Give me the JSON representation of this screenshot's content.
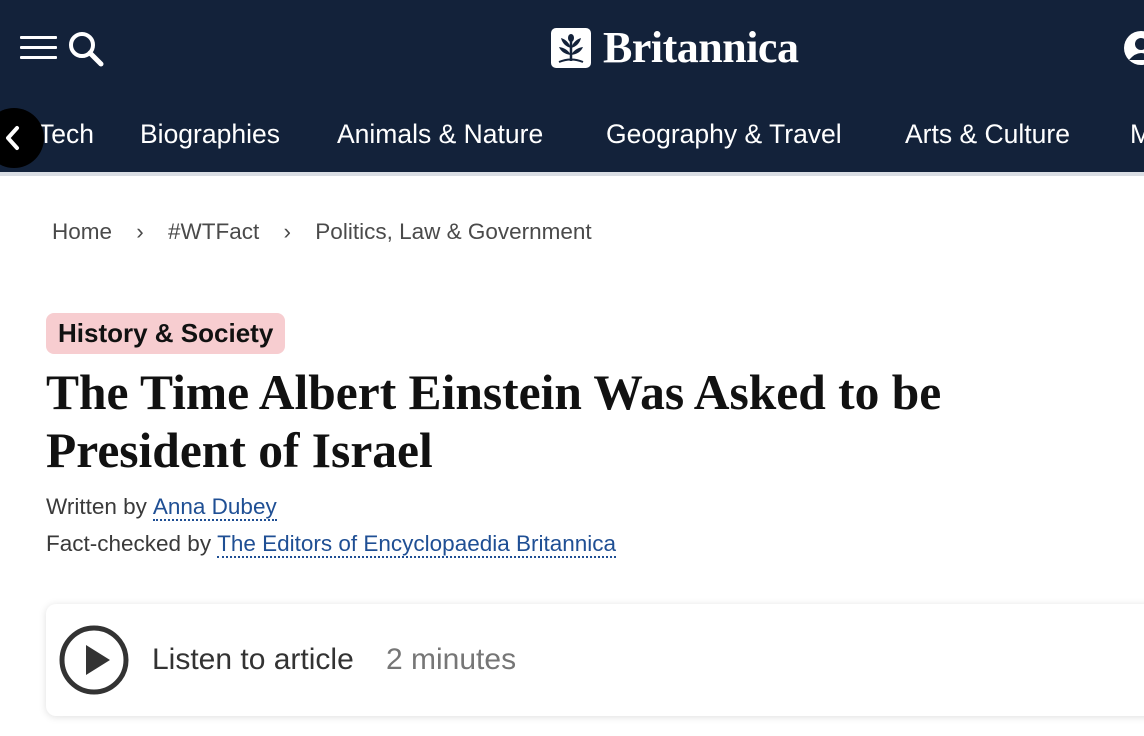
{
  "header": {
    "logo_text": "Britannica",
    "background": "#13223a",
    "icons": {
      "menu": "hamburger-menu-icon",
      "search": "search-icon",
      "account": "user-account-icon",
      "logo": "thistle-logo-icon",
      "nav_prev": "chevron-left-icon"
    },
    "nav": {
      "items": [
        {
          "label": "Tech"
        },
        {
          "label": "Biographies"
        },
        {
          "label": "Animals & Nature"
        },
        {
          "label": "Geography & Travel"
        },
        {
          "label": "Arts & Culture"
        },
        {
          "label": "M"
        }
      ]
    }
  },
  "breadcrumb": {
    "items": [
      {
        "label": "Home"
      },
      {
        "label": "#WTFact"
      },
      {
        "label": "Politics, Law & Government"
      }
    ],
    "separator": "›"
  },
  "article": {
    "category": "History & Society",
    "category_color": "#f7cdd0",
    "title": "The Time Albert Einstein Was Asked to be President of Israel",
    "written_by_label": "Written by",
    "author": "Anna Dubey",
    "fact_checked_label": "Fact-checked by",
    "fact_checker": "The Editors of Encyclopaedia Britannica",
    "link_color": "#1f4f94"
  },
  "audio": {
    "label": "Listen to article",
    "duration": "2 minutes",
    "icon": "play-circle-icon"
  }
}
